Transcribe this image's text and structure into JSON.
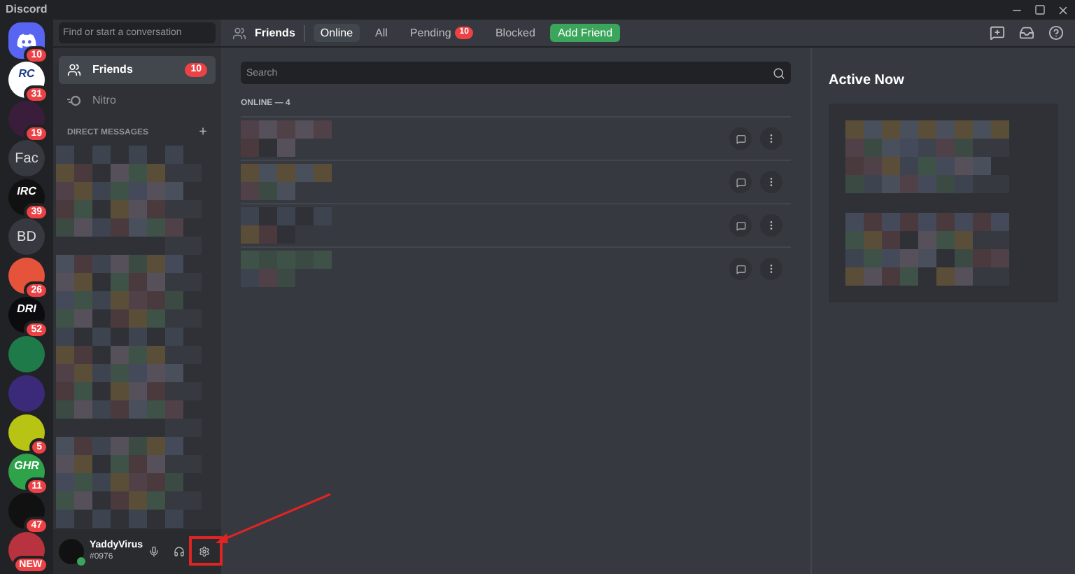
{
  "window": {
    "title": "Discord"
  },
  "servers": [
    {
      "kind": "home",
      "badge": "10",
      "color": "#5865f2"
    },
    {
      "kind": "logo",
      "label": "RC",
      "badge": "31",
      "color": "#ffffff"
    },
    {
      "kind": "logo",
      "badge": "19",
      "color": "#3a1d3a"
    },
    {
      "kind": "text",
      "label": "Fac",
      "color": "#36393f"
    },
    {
      "kind": "logo",
      "label": "IRC",
      "badge": "39",
      "color": "#111111"
    },
    {
      "kind": "text",
      "label": "BD",
      "color": "#36393f"
    },
    {
      "kind": "logo",
      "badge": "26",
      "color": "#e4533a"
    },
    {
      "kind": "logo",
      "label": "DRI",
      "badge": "52",
      "color": "#0c0c0e"
    },
    {
      "kind": "logo",
      "color": "#1f7a4a"
    },
    {
      "kind": "logo",
      "color": "#3b2a7a"
    },
    {
      "kind": "logo",
      "badge": "5",
      "color": "#b8c414"
    },
    {
      "kind": "logo",
      "label": "GHR",
      "badge": "11",
      "color": "#2fa34a"
    },
    {
      "kind": "logo",
      "badge": "47",
      "color": "#111111"
    },
    {
      "kind": "logo",
      "badge": "NEW",
      "color": "#b8333f"
    }
  ],
  "dm_search": {
    "placeholder": "Find or start a conversation"
  },
  "nav": [
    {
      "label": "Friends",
      "selected": true,
      "badge": "10"
    },
    {
      "label": "Nitro",
      "selected": false
    }
  ],
  "dm_header": "DIRECT MESSAGES",
  "dm_add": "+",
  "user": {
    "name": "YaddyVirus",
    "tag": "#0976",
    "online": true
  },
  "header": {
    "title": "Friends",
    "tabs": [
      {
        "label": "Online",
        "selected": true
      },
      {
        "label": "All",
        "selected": false
      },
      {
        "label": "Pending",
        "selected": false,
        "badge": "10"
      },
      {
        "label": "Blocked",
        "selected": false
      }
    ],
    "add_friend": "Add Friend"
  },
  "search": {
    "placeholder": "Search"
  },
  "online_header": "ONLINE — 4",
  "friends": [
    {
      "kind": "blurred"
    },
    {
      "kind": "blurred"
    },
    {
      "kind": "blurred"
    },
    {
      "kind": "blurred"
    }
  ],
  "active_now": {
    "title": "Active Now"
  }
}
